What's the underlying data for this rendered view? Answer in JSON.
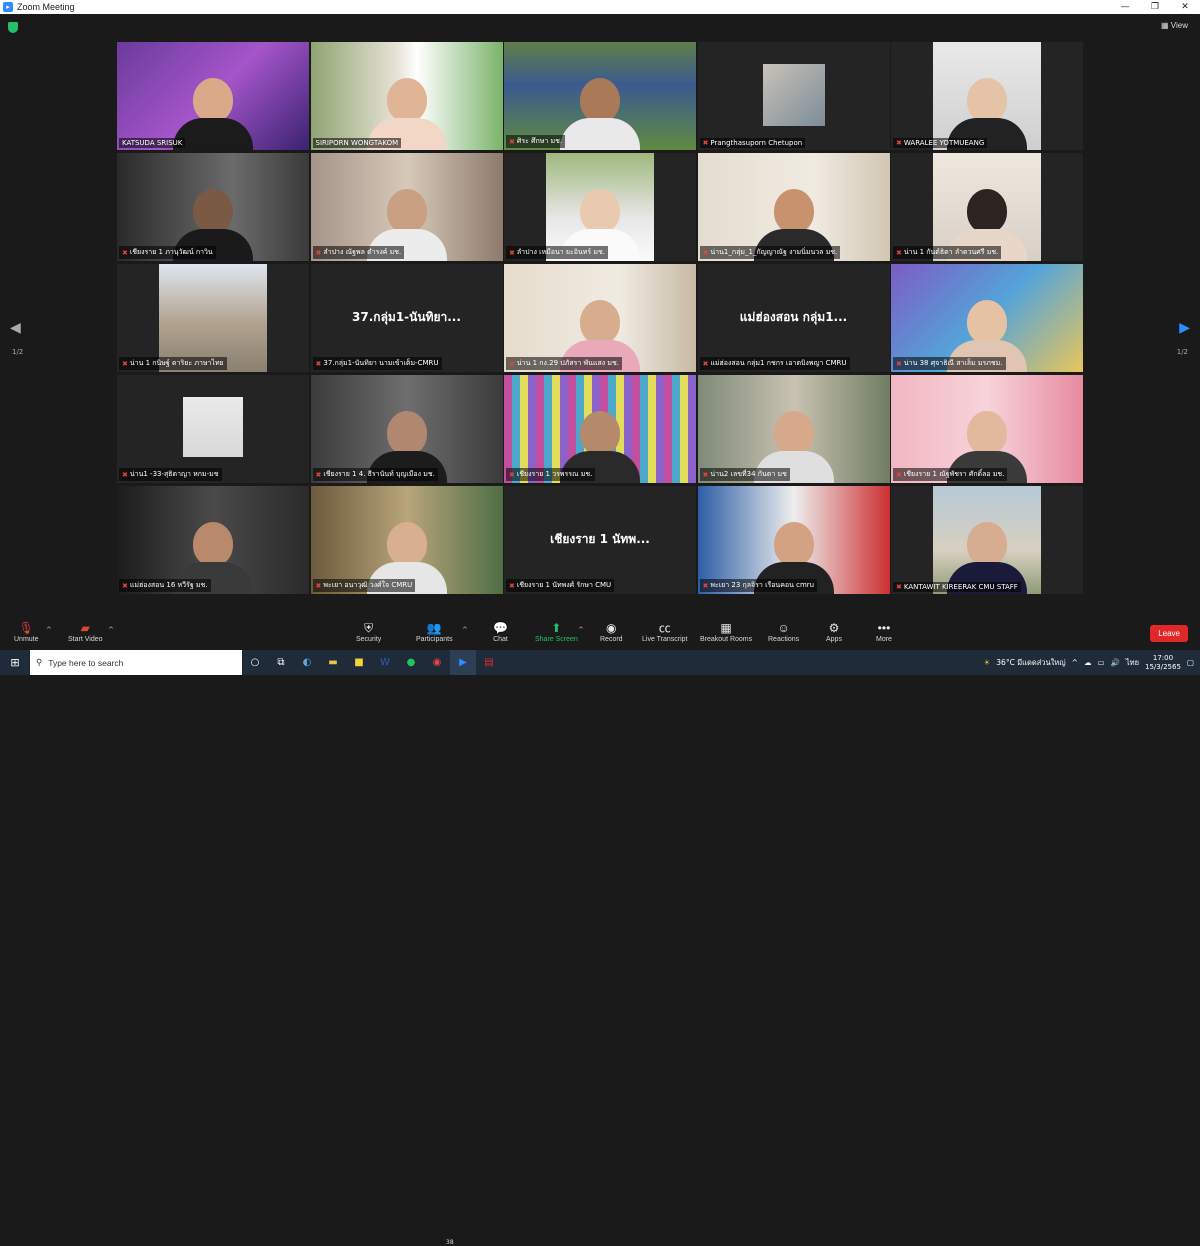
{
  "window": {
    "title": "Zoom Meeting",
    "min": "—",
    "max": "❐",
    "close": "✕"
  },
  "view_button": "View",
  "pages": {
    "left": "1/2",
    "right": "1/2"
  },
  "tiles": [
    {
      "name": "KATSUDA SRISUK",
      "muted": false
    },
    {
      "name": "SIRIPORN WONGTAKOM",
      "muted": false
    },
    {
      "name": "ศิระ ศึกษา มช.",
      "muted": true,
      "active": true
    },
    {
      "name": "Prangthasuporn Chetupon",
      "muted": true
    },
    {
      "name": "WARALEE YOTMUEANG",
      "muted": true
    },
    {
      "name": "เชียงราย 1 ภานุวัฒน์ กาวิน",
      "muted": true
    },
    {
      "name": "ลำปาง ณัฐพล ดำรงค์ มช.",
      "muted": true
    },
    {
      "name": "ลำปาง เหมือนา ยะอินทร์ มช.",
      "muted": true
    },
    {
      "name": "น่าน1_กลุ่ม_1_กัญญาณัฐ งามนิ่มนวล มช.",
      "muted": true
    },
    {
      "name": "น่าน 1 กันต์ธิดา ลำดวนศรี มช.",
      "muted": true
    },
    {
      "name": "น่าน 1 กนิษฐ์ ดาริยะ ภาษาไทย",
      "muted": true
    },
    {
      "name": "37.กลุ่ม1-นันทิยา นามเข้าเต็ม-CMRU",
      "muted": true,
      "big": "37.กลุ่ม1-นันทิยา..."
    },
    {
      "name": "น่าน 1 กง.29 ปภัสรา พันแสง มช.",
      "muted": true
    },
    {
      "name": "แม่ฮ่องสอน กลุ่ม1 กชกร เอาตบิงพญา CMRU",
      "muted": true,
      "big": "แม่ฮ่องสอน กลุ่ม1..."
    },
    {
      "name": "น่าน 38 ศุจาธิณี สาเล็ม มรภชม.",
      "muted": true
    },
    {
      "name": "น่าน1 -33-สุธิดาญา หกม-มช",
      "muted": true
    },
    {
      "name": "เชียงราย 1 4. ธีรานันท์ บุญเมือง มช.",
      "muted": true
    },
    {
      "name": "เชียงราย 1 วรพรรณ มช.",
      "muted": true
    },
    {
      "name": "น่าน2 เลขที่34 กันตา มช",
      "muted": true
    },
    {
      "name": "เชียงราย 1 ณัฐพัชรา ศักดิ์ลอ มช.",
      "muted": true
    },
    {
      "name": "แม่ฮ่องสอน 16 หวีรัฐ มช.",
      "muted": true
    },
    {
      "name": "พะเยา อนาวุฒิ วงศ์ใจ CMRU",
      "muted": true
    },
    {
      "name": "เชียงราย 1 นัทพงศ์ รักษา CMU",
      "muted": true,
      "big": "เชียงราย 1 นัทพ..."
    },
    {
      "name": "พะเยา 23 กุลจิรา เรือนคอน cmru",
      "muted": true
    },
    {
      "name": "KANTAWIT KIREERAK CMU STAFF",
      "muted": true
    }
  ],
  "toolbar": {
    "unmute": "Unmute",
    "start_video": "Start Video",
    "security": "Security",
    "participants": "Participants",
    "participants_count": "38",
    "chat": "Chat",
    "share_screen": "Share Screen",
    "record": "Record",
    "live_transcript": "Live Transcript",
    "breakout_rooms": "Breakout Rooms",
    "reactions": "Reactions",
    "apps": "Apps",
    "more": "More",
    "leave": "Leave"
  },
  "taskbar": {
    "search_placeholder": "Type here to search",
    "weather": "36°C มีแดดส่วนใหญ่",
    "lang": "ไทย",
    "time": "17:00",
    "date": "15/3/2565"
  },
  "colors": {
    "accent_blue": "#2d8cff",
    "leave_red": "#e02828",
    "share_green": "#23c16b",
    "active_border": "#d8d84a"
  }
}
